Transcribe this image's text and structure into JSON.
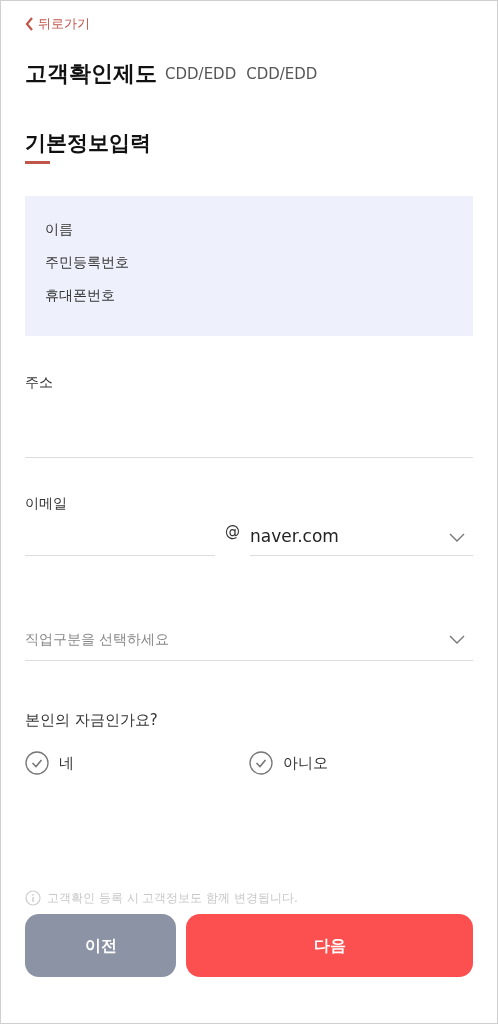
{
  "back": {
    "label": "뒤로가기"
  },
  "title": {
    "main": "고객확인제도",
    "subs": [
      "CDD/EDD",
      "CDD/EDD"
    ]
  },
  "section": {
    "heading": "기본정보입력"
  },
  "info_box": {
    "lines": [
      "이름",
      "주민등록번호",
      "휴대폰번호"
    ]
  },
  "address": {
    "label": "주소"
  },
  "email": {
    "label": "이메일",
    "at": "@",
    "domain": "naver.com"
  },
  "job": {
    "placeholder": "직업구분을 선택하세요"
  },
  "own_funds": {
    "question": "본인의 자금인가요?",
    "options": [
      {
        "label": "네",
        "selected": false
      },
      {
        "label": "아니오",
        "selected": false
      }
    ]
  },
  "notice": "고객확인 등록 시 고객정보도 함께 변경됩니다.",
  "buttons": [
    {
      "label": "이전",
      "kind": "secondary"
    },
    {
      "label": "다음",
      "kind": "primary"
    }
  ]
}
